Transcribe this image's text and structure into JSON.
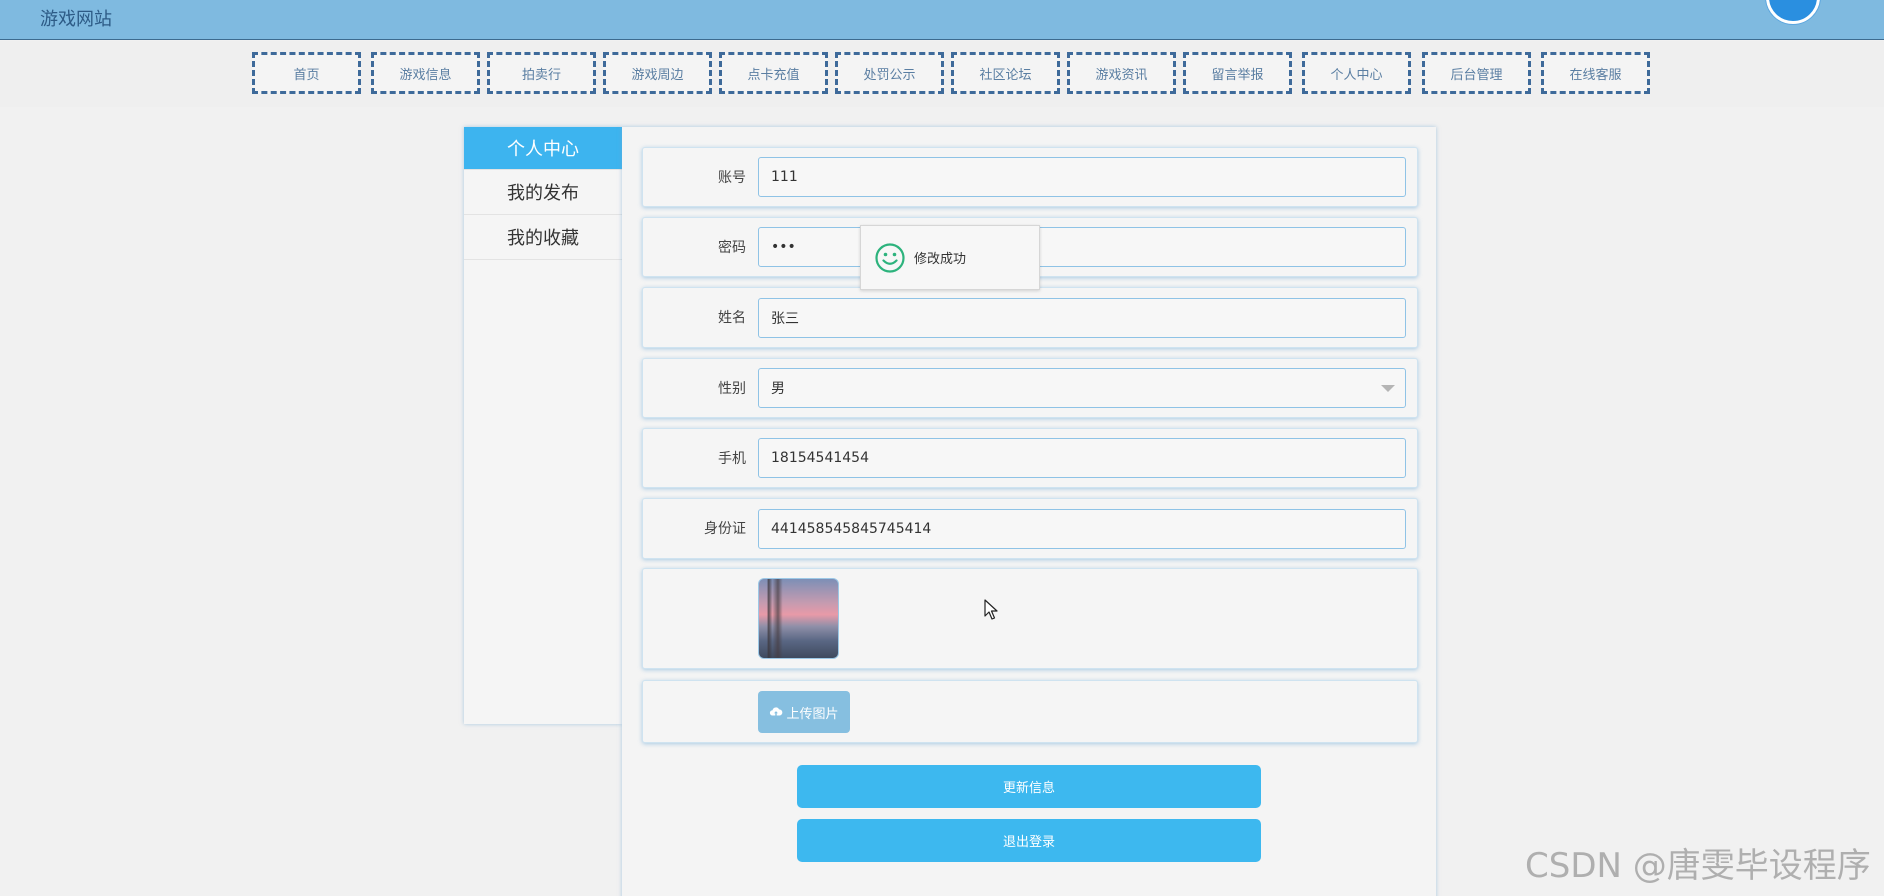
{
  "header": {
    "site_title": "游戏网站"
  },
  "nav": {
    "items": [
      {
        "label": "首页"
      },
      {
        "label": "游戏信息"
      },
      {
        "label": "拍卖行"
      },
      {
        "label": "游戏周边"
      },
      {
        "label": "点卡充值"
      },
      {
        "label": "处罚公示"
      },
      {
        "label": "社区论坛"
      },
      {
        "label": "游戏资讯"
      },
      {
        "label": "留言举报"
      },
      {
        "label": "个人中心"
      },
      {
        "label": "后台管理"
      },
      {
        "label": "在线客服"
      }
    ]
  },
  "sidebar": {
    "items": [
      {
        "label": "个人中心",
        "active": true
      },
      {
        "label": "我的发布"
      },
      {
        "label": "我的收藏"
      }
    ]
  },
  "form": {
    "account": {
      "label": "账号",
      "value": "111"
    },
    "password": {
      "label": "密码",
      "value": "•••"
    },
    "name": {
      "label": "姓名",
      "value": "张三"
    },
    "gender": {
      "label": "性别",
      "value": "男"
    },
    "phone": {
      "label": "手机",
      "value": "18154541454"
    },
    "id_card": {
      "label": "身份证",
      "value": "441458545845745414"
    },
    "upload_label": "上传图片",
    "update_button": "更新信息",
    "logout_button": "退出登录"
  },
  "toast": {
    "message": "修改成功"
  },
  "watermark": "CSDN @唐雯毕设程序",
  "colors": {
    "accent": "#3db8ef",
    "header": "#7fbae0",
    "nav_border": "#3e6a9a",
    "toast_icon": "#2db37d"
  },
  "icons": {
    "toast": "smile-icon",
    "upload": "cloud-upload-icon",
    "select": "chevron-down-icon",
    "cursor": "mouse-cursor-icon"
  }
}
